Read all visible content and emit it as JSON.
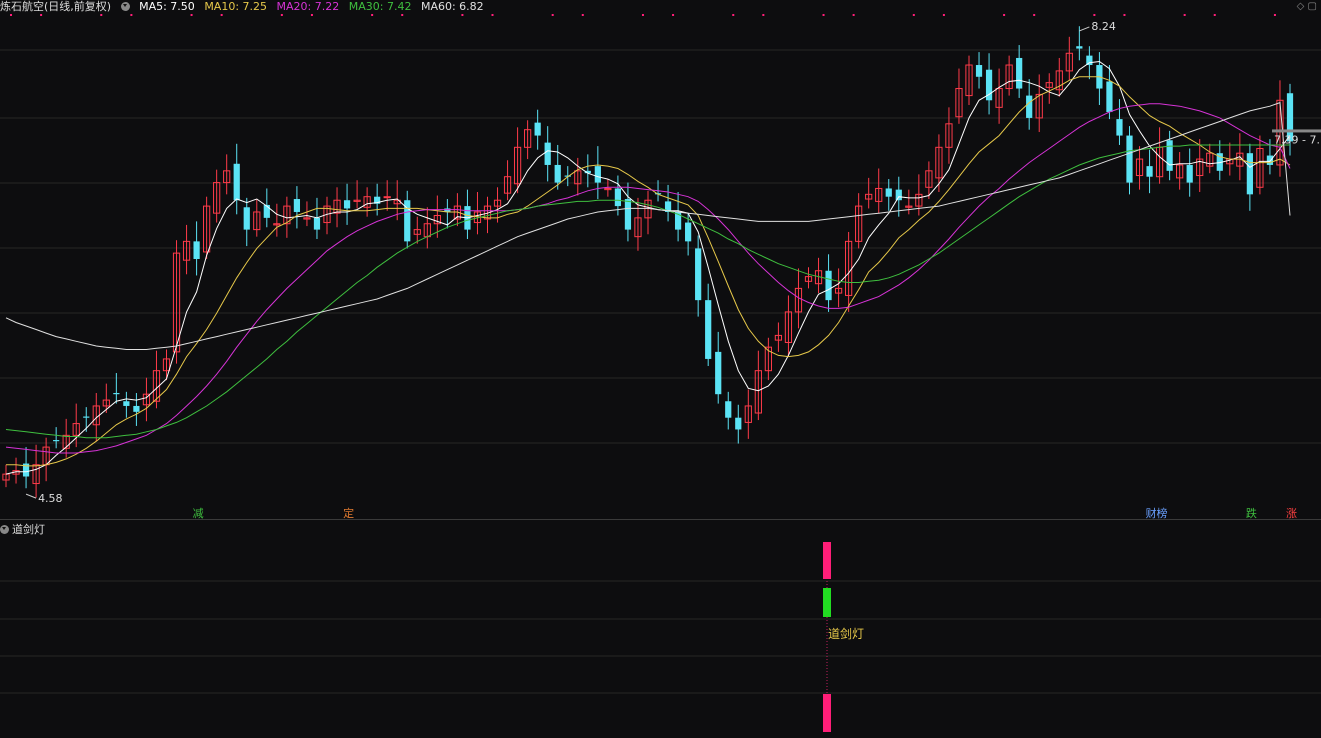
{
  "header": {
    "title": "炼石航空(日线,前复权)",
    "ma": [
      {
        "label": "MA5: 7.50",
        "color": "#ffffff"
      },
      {
        "label": "MA10: 7.25",
        "color": "#e6c84a"
      },
      {
        "label": "MA20: 7.22",
        "color": "#d633d6"
      },
      {
        "label": "MA30: 7.42",
        "color": "#3fbf3f"
      },
      {
        "label": "MA60: 6.82",
        "color": "#e0e0e0"
      }
    ],
    "icons": [
      "diamond-icon",
      "restore-icon"
    ]
  },
  "price_labels": {
    "high": "8.24",
    "low": "4.58",
    "current": "7.39 - 7."
  },
  "event_tags": [
    {
      "label": "减",
      "color": "#3fbf3f"
    },
    {
      "label": "定",
      "color": "#e07a30"
    },
    {
      "label": "财榜",
      "color": "#6aa0ff"
    },
    {
      "label": "跌",
      "color": "#3fbf3f"
    },
    {
      "label": "涨",
      "color": "#ff4040"
    }
  ],
  "indicator": {
    "title": "道剑灯",
    "signal_label": "道剑灯"
  },
  "colors": {
    "up": "#ff3b4a",
    "down": "#5be3f5",
    "signal_pink": "#ff1e78",
    "signal_green": "#22dd22",
    "grid": "#262626"
  },
  "chart_data": {
    "type": "candlestick",
    "price_range": [
      4.4,
      8.5
    ],
    "closes": [
      4.62,
      4.65,
      4.6,
      4.7,
      4.85,
      4.9,
      4.95,
      5.05,
      5.1,
      5.2,
      5.25,
      5.3,
      5.2,
      5.15,
      5.3,
      5.5,
      5.6,
      6.5,
      6.6,
      6.45,
      6.9,
      7.1,
      7.2,
      6.95,
      6.7,
      6.85,
      6.8,
      6.75,
      6.9,
      6.85,
      6.8,
      6.7,
      6.9,
      6.95,
      6.88,
      6.95,
      6.98,
      6.92,
      6.98,
      6.95,
      6.6,
      6.7,
      6.75,
      6.82,
      6.85,
      6.9,
      6.7,
      6.85,
      6.9,
      6.95,
      7.15,
      7.4,
      7.55,
      7.5,
      7.25,
      7.1,
      7.15,
      7.2,
      7.18,
      7.1,
      7.05,
      6.9,
      6.7,
      6.8,
      6.95,
      7.0,
      6.85,
      6.7,
      6.6,
      6.1,
      5.6,
      5.3,
      5.1,
      5.0,
      5.2,
      5.5,
      5.7,
      5.8,
      6.0,
      6.2,
      6.3,
      6.35,
      6.1,
      6.2,
      6.6,
      6.9,
      7.0,
      7.05,
      6.98,
      6.95,
      6.9,
      7.0,
      7.2,
      7.4,
      7.6,
      7.9,
      8.1,
      8.0,
      7.8,
      7.9,
      8.1,
      7.9,
      7.65,
      7.85,
      7.95,
      8.05,
      8.2,
      8.24,
      8.1,
      7.9,
      7.7,
      7.5,
      7.1,
      7.3,
      7.15,
      7.4,
      7.2,
      7.25,
      7.1,
      7.3,
      7.35,
      7.2,
      7.3,
      7.35,
      7.0,
      7.39,
      7.25,
      7.8,
      7.45
    ],
    "series": [
      {
        "name": "MA5",
        "values": [
          4.62,
          4.64,
          4.64,
          4.66,
          4.7,
          4.78,
          4.85,
          4.93,
          5.01,
          5.1,
          5.17,
          5.24,
          5.26,
          5.25,
          5.27,
          5.35,
          5.43,
          5.71,
          6.0,
          6.17,
          6.48,
          6.71,
          6.88,
          6.96,
          6.93,
          6.96,
          6.9,
          6.83,
          6.8,
          6.81,
          6.82,
          6.8,
          6.83,
          6.85,
          6.85,
          6.87,
          6.92,
          6.93,
          6.95,
          6.96,
          6.88,
          6.83,
          6.8,
          6.77,
          6.74,
          6.81,
          6.8,
          6.82,
          6.84,
          6.87,
          6.92,
          7.05,
          7.2,
          7.31,
          7.37,
          7.36,
          7.31,
          7.24,
          7.18,
          7.15,
          7.13,
          7.09,
          6.98,
          6.91,
          6.89,
          6.87,
          6.86,
          6.86,
          6.84,
          6.68,
          6.38,
          6.06,
          5.75,
          5.5,
          5.35,
          5.33,
          5.37,
          5.47,
          5.63,
          5.82,
          6.0,
          6.15,
          6.19,
          6.24,
          6.33,
          6.45,
          6.63,
          6.74,
          6.84,
          6.98,
          6.97,
          6.97,
          6.99,
          7.09,
          7.21,
          7.43,
          7.65,
          7.8,
          7.85,
          7.91,
          7.96,
          7.97,
          7.95,
          7.92,
          7.87,
          7.84,
          7.94,
          8.06,
          8.12,
          8.13,
          8.07,
          7.92,
          7.68,
          7.54,
          7.41,
          7.32,
          7.25,
          7.26,
          7.26,
          7.28,
          7.26,
          7.27,
          7.29,
          7.32,
          7.23,
          7.28,
          7.28,
          7.39,
          7.5
        ]
      },
      {
        "name": "MA10",
        "values": [
          4.7,
          4.7,
          4.69,
          4.69,
          4.7,
          4.72,
          4.75,
          4.79,
          4.84,
          4.9,
          4.97,
          5.04,
          5.09,
          5.13,
          5.18,
          5.26,
          5.34,
          5.47,
          5.62,
          5.73,
          5.85,
          5.99,
          6.14,
          6.29,
          6.42,
          6.54,
          6.63,
          6.72,
          6.76,
          6.82,
          6.85,
          6.88,
          6.88,
          6.87,
          6.86,
          6.86,
          6.86,
          6.87,
          6.88,
          6.88,
          6.88,
          6.88,
          6.87,
          6.86,
          6.85,
          6.85,
          6.82,
          6.81,
          6.8,
          6.8,
          6.83,
          6.85,
          6.9,
          6.96,
          7.02,
          7.08,
          7.15,
          7.21,
          7.24,
          7.25,
          7.24,
          7.22,
          7.17,
          7.11,
          7.06,
          7.0,
          6.97,
          6.94,
          6.91,
          6.82,
          6.63,
          6.43,
          6.22,
          6.02,
          5.86,
          5.75,
          5.67,
          5.63,
          5.62,
          5.63,
          5.66,
          5.72,
          5.8,
          5.91,
          6.05,
          6.19,
          6.34,
          6.42,
          6.52,
          6.63,
          6.7,
          6.78,
          6.85,
          6.94,
          7.04,
          7.15,
          7.26,
          7.36,
          7.43,
          7.5,
          7.6,
          7.7,
          7.78,
          7.84,
          7.88,
          7.92,
          7.97,
          8.0,
          8.0,
          8.0,
          7.97,
          7.92,
          7.83,
          7.75,
          7.67,
          7.62,
          7.58,
          7.52,
          7.47,
          7.42,
          7.36,
          7.32,
          7.3,
          7.3,
          7.27,
          7.27,
          7.27,
          7.3,
          7.25
        ]
      },
      {
        "name": "MA20",
        "values": [
          4.85,
          4.84,
          4.83,
          4.82,
          4.81,
          4.8,
          4.8,
          4.8,
          4.81,
          4.82,
          4.84,
          4.86,
          4.89,
          4.92,
          4.95,
          5.0,
          5.05,
          5.12,
          5.2,
          5.28,
          5.37,
          5.47,
          5.58,
          5.7,
          5.81,
          5.92,
          6.02,
          6.11,
          6.2,
          6.28,
          6.36,
          6.44,
          6.52,
          6.58,
          6.64,
          6.69,
          6.73,
          6.77,
          6.8,
          6.83,
          6.85,
          6.86,
          6.87,
          6.87,
          6.87,
          6.87,
          6.86,
          6.86,
          6.86,
          6.86,
          6.86,
          6.87,
          6.88,
          6.9,
          6.92,
          6.95,
          6.97,
          7.0,
          7.03,
          7.05,
          7.06,
          7.06,
          7.06,
          7.05,
          7.04,
          7.03,
          7.02,
          7.0,
          6.98,
          6.94,
          6.87,
          6.79,
          6.7,
          6.6,
          6.5,
          6.41,
          6.33,
          6.25,
          6.18,
          6.12,
          6.08,
          6.05,
          6.03,
          6.03,
          6.04,
          6.07,
          6.1,
          6.13,
          6.18,
          6.23,
          6.29,
          6.36,
          6.44,
          6.53,
          6.62,
          6.72,
          6.81,
          6.9,
          6.98,
          7.05,
          7.13,
          7.2,
          7.27,
          7.33,
          7.39,
          7.45,
          7.51,
          7.57,
          7.62,
          7.66,
          7.7,
          7.73,
          7.75,
          7.76,
          7.77,
          7.77,
          7.76,
          7.75,
          7.73,
          7.71,
          7.68,
          7.65,
          7.6,
          7.55,
          7.5,
          7.46,
          7.42,
          7.4,
          7.22
        ]
      },
      {
        "name": "MA30",
        "values": [
          5.0,
          4.99,
          4.98,
          4.97,
          4.96,
          4.95,
          4.94,
          4.94,
          4.93,
          4.93,
          4.93,
          4.94,
          4.95,
          4.96,
          4.98,
          5.0,
          5.03,
          5.06,
          5.1,
          5.15,
          5.2,
          5.26,
          5.32,
          5.39,
          5.46,
          5.53,
          5.6,
          5.68,
          5.75,
          5.83,
          5.9,
          5.97,
          6.04,
          6.11,
          6.18,
          6.25,
          6.31,
          6.38,
          6.44,
          6.5,
          6.55,
          6.6,
          6.64,
          6.68,
          6.72,
          6.75,
          6.78,
          6.8,
          6.82,
          6.84,
          6.86,
          6.87,
          6.88,
          6.9,
          6.91,
          6.92,
          6.93,
          6.94,
          6.94,
          6.95,
          6.95,
          6.95,
          6.94,
          6.93,
          6.91,
          6.89,
          6.86,
          6.83,
          6.79,
          6.75,
          6.71,
          6.67,
          6.62,
          6.58,
          6.53,
          6.49,
          6.45,
          6.41,
          6.38,
          6.35,
          6.32,
          6.3,
          6.28,
          6.26,
          6.25,
          6.25,
          6.26,
          6.27,
          6.29,
          6.32,
          6.36,
          6.4,
          6.45,
          6.5,
          6.56,
          6.62,
          6.68,
          6.74,
          6.8,
          6.86,
          6.92,
          6.98,
          7.03,
          7.08,
          7.13,
          7.17,
          7.21,
          7.25,
          7.28,
          7.31,
          7.33,
          7.35,
          7.37,
          7.38,
          7.39,
          7.4,
          7.41,
          7.41,
          7.42,
          7.42,
          7.42,
          7.42,
          7.42,
          7.42,
          7.42,
          7.42,
          7.42,
          7.42,
          7.42
        ]
      },
      {
        "name": "MA60",
        "values": [
          5.95,
          5.91,
          5.88,
          5.85,
          5.82,
          5.79,
          5.77,
          5.75,
          5.73,
          5.71,
          5.7,
          5.69,
          5.68,
          5.68,
          5.68,
          5.69,
          5.7,
          5.71,
          5.73,
          5.75,
          5.77,
          5.79,
          5.81,
          5.83,
          5.85,
          5.87,
          5.89,
          5.91,
          5.93,
          5.95,
          5.97,
          5.99,
          6.01,
          6.03,
          6.05,
          6.07,
          6.09,
          6.11,
          6.14,
          6.17,
          6.2,
          6.24,
          6.28,
          6.32,
          6.36,
          6.4,
          6.44,
          6.48,
          6.52,
          6.56,
          6.6,
          6.64,
          6.67,
          6.7,
          6.73,
          6.76,
          6.79,
          6.81,
          6.83,
          6.85,
          6.86,
          6.87,
          6.88,
          6.88,
          6.88,
          6.87,
          6.86,
          6.85,
          6.84,
          6.83,
          6.82,
          6.81,
          6.8,
          6.79,
          6.78,
          6.77,
          6.77,
          6.77,
          6.77,
          6.77,
          6.77,
          6.78,
          6.79,
          6.8,
          6.81,
          6.82,
          6.83,
          6.84,
          6.85,
          6.86,
          6.87,
          6.88,
          6.89,
          6.9,
          6.92,
          6.94,
          6.96,
          6.98,
          7.0,
          7.02,
          7.04,
          7.06,
          7.08,
          7.1,
          7.12,
          7.14,
          7.17,
          7.2,
          7.23,
          7.26,
          7.29,
          7.32,
          7.35,
          7.38,
          7.41,
          7.44,
          7.47,
          7.5,
          7.53,
          7.56,
          7.59,
          7.62,
          7.65,
          7.68,
          7.71,
          7.73,
          7.75,
          7.78,
          6.82
        ]
      }
    ]
  }
}
